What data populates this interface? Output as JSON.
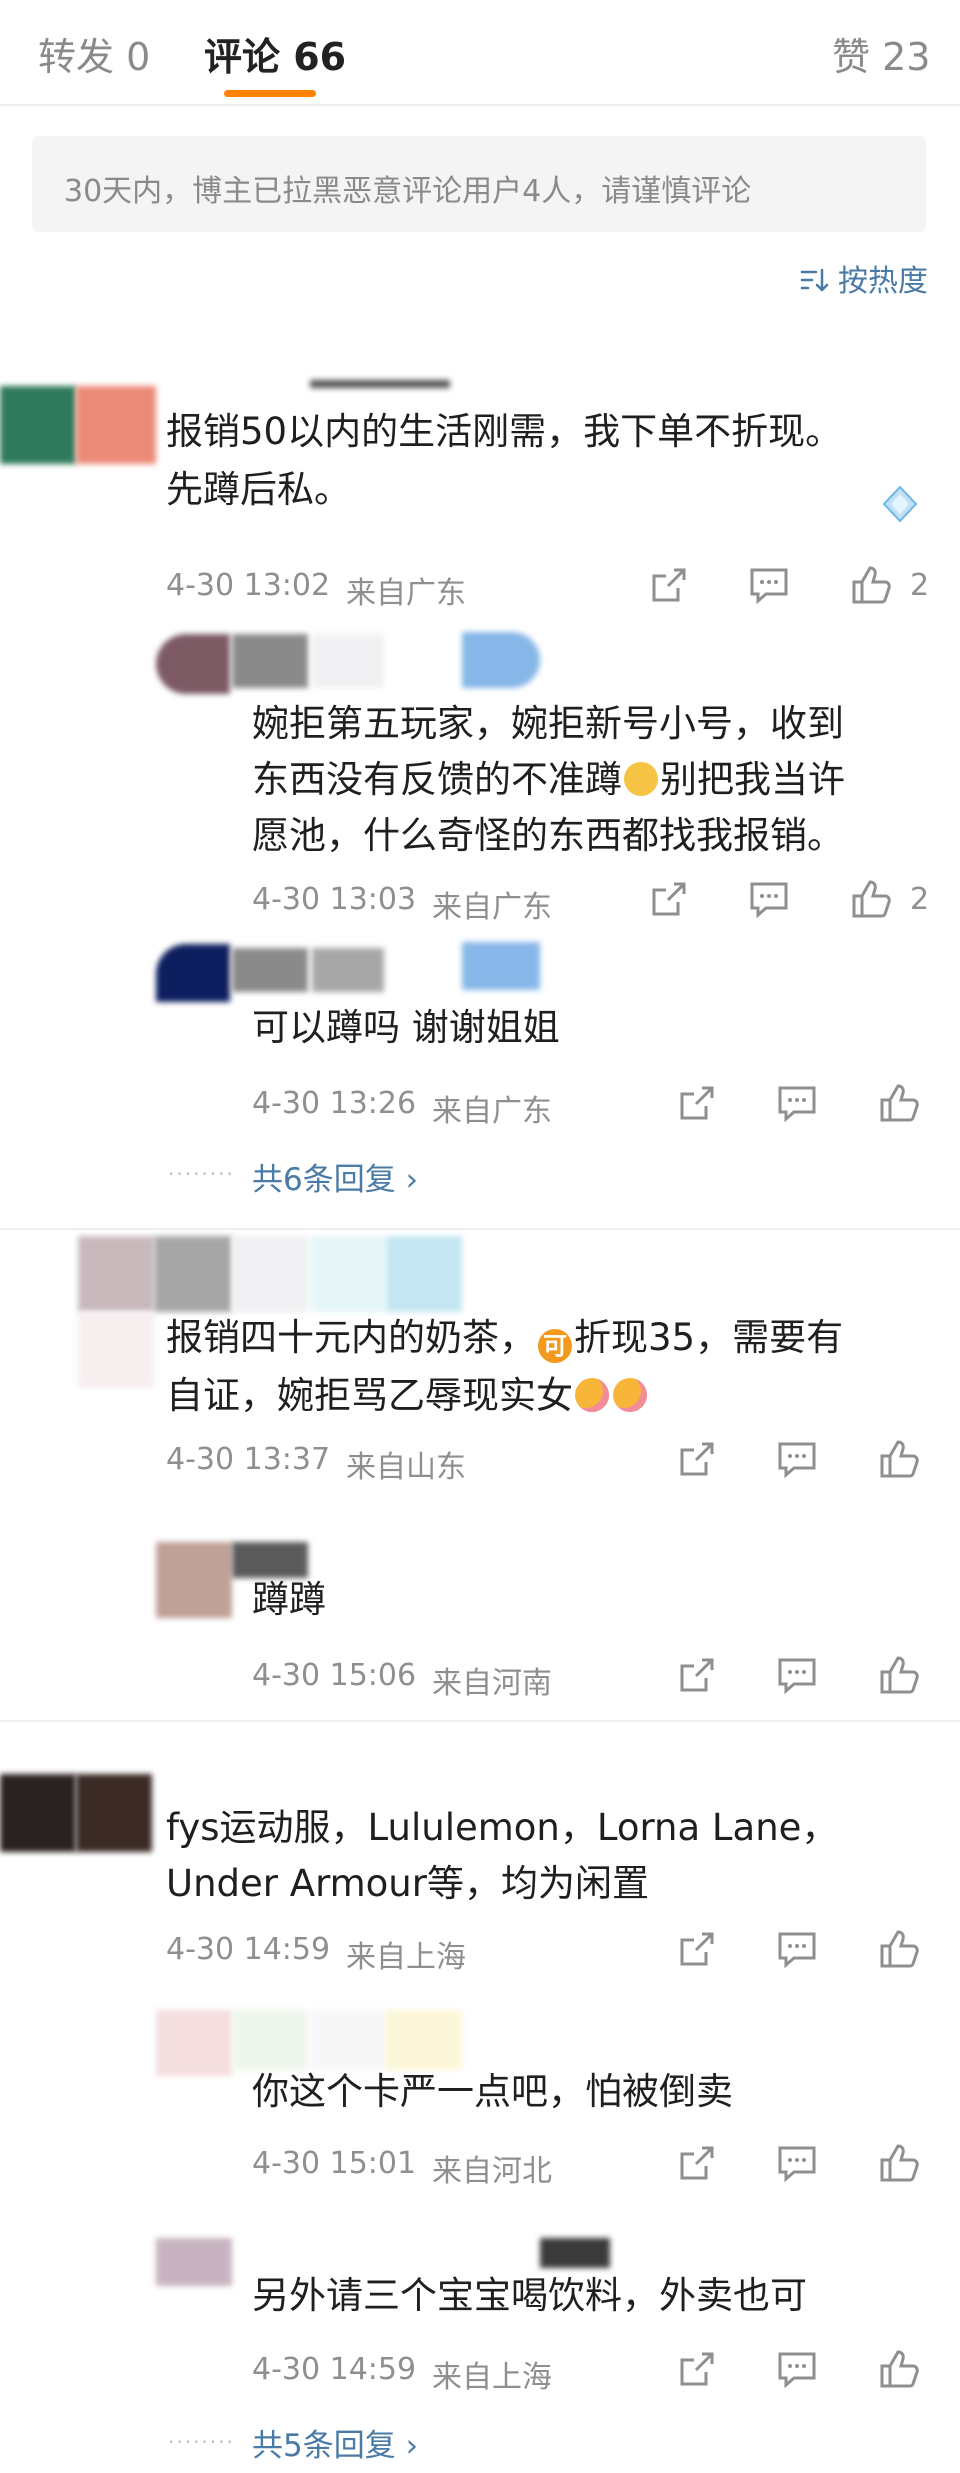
{
  "tabs": {
    "reposts": "转发 0",
    "comments": "评论 66",
    "likes": "赞 23"
  },
  "notice": "30天内，博主已拉黑恶意评论用户4人，请谨慎评论",
  "sort_label": "按热度",
  "comments": [
    {
      "line1": "报销50以内的生活刚需，我下单不折现。",
      "line2": "先蹲后私。",
      "time": "4-30 13:02",
      "location": "来自广东",
      "likes": "2"
    },
    {
      "line1": "婉拒第五玩家，婉拒新号小号，收到",
      "line2a": "东西没有反馈的不准蹲",
      "line2b": "别把我当许",
      "line3": "愿池，什么奇怪的东西都找我报销。",
      "time": "4-30 13:03",
      "location": "来自广东",
      "likes": "2"
    },
    {
      "line1": "可以蹲吗 谢谢姐姐",
      "time": "4-30 13:26",
      "location": "来自广东"
    },
    {
      "line1a": "报销四十元内的奶茶，",
      "line1b": "折现35，需要有",
      "line2": "自证，婉拒骂乙辱现实女",
      "time": "4-30 13:37",
      "location": "来自山东"
    },
    {
      "line1": "蹲蹲",
      "time": "4-30 15:06",
      "location": "来自河南"
    },
    {
      "line1": "fys运动服，Lululemon，Lorna Lane，",
      "line2": "Under Armour等，均为闲置",
      "time": "4-30 14:59",
      "location": "来自上海"
    },
    {
      "line1": "你这个卡严一点吧，怕被倒卖",
      "time": "4-30 15:01",
      "location": "来自河北"
    },
    {
      "line1": "另外请三个宝宝喝饮料，外卖也可",
      "time": "4-30 14:59",
      "location": "来自上海"
    }
  ],
  "reply_counts": {
    "first": "共6条回复",
    "second": "共5条回复"
  },
  "icons": [
    "share-icon",
    "comment-icon",
    "like-icon",
    "chevron-right-icon",
    "sort-icon"
  ],
  "colors": {
    "accent": "#ff8200",
    "link": "#4a7aa6",
    "muted": "#8f8f8f"
  }
}
